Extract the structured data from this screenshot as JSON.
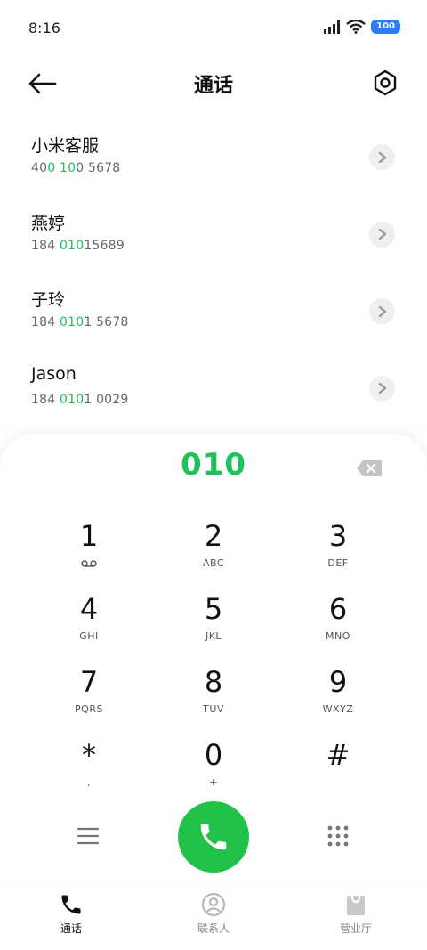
{
  "status": {
    "time": "8:16",
    "battery": "100"
  },
  "header": {
    "title": "通话"
  },
  "contacts": [
    {
      "name": "小米客服",
      "number_parts": [
        "40",
        "0",
        " ",
        "10",
        "0 5678"
      ]
    },
    {
      "name": "燕婷",
      "number_parts": [
        "184 ",
        "010",
        "15689"
      ]
    },
    {
      "name": "子玲",
      "number_parts": [
        "184 ",
        "010",
        "1 5678"
      ]
    },
    {
      "name": "Jason",
      "number_parts": [
        "184 ",
        "010",
        "1 0029"
      ]
    }
  ],
  "dialer": {
    "input": "010",
    "keys": [
      {
        "digit": "1",
        "letters": ""
      },
      {
        "digit": "2",
        "letters": "ABC"
      },
      {
        "digit": "3",
        "letters": "DEF"
      },
      {
        "digit": "4",
        "letters": "GHI"
      },
      {
        "digit": "5",
        "letters": "JKL"
      },
      {
        "digit": "6",
        "letters": "MNO"
      },
      {
        "digit": "7",
        "letters": "PQRS"
      },
      {
        "digit": "8",
        "letters": "TUV"
      },
      {
        "digit": "9",
        "letters": "WXYZ"
      },
      {
        "digit": "*",
        "letters": ","
      },
      {
        "digit": "0",
        "letters": "+"
      },
      {
        "digit": "#",
        "letters": ""
      }
    ]
  },
  "nav": {
    "calls": "通话",
    "contacts": "联系人",
    "store": "营业厅"
  },
  "colors": {
    "accent": "#22c24a",
    "highlight": "#1ec15a",
    "battery": "#2f7bf6"
  }
}
